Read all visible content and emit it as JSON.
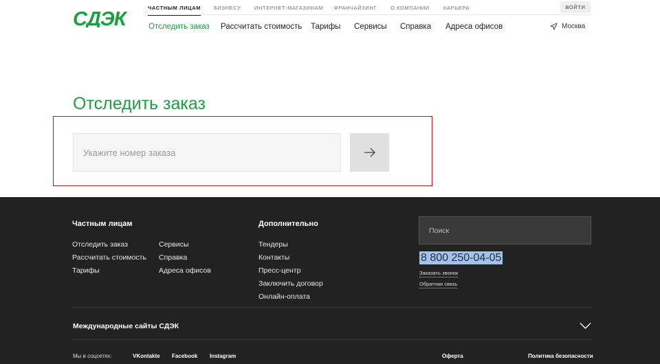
{
  "header": {
    "logo_text": "СДЭК",
    "top_nav": [
      "ЧАСТНЫМ ЛИЦАМ",
      "БИЗНЕСУ",
      "ИНТЕРНЕТ-МАГАЗИНАМ",
      "ФРАНЧАЙЗИНГ",
      "О КОМПАНИИ",
      "КАРЬЕРА"
    ],
    "login_label": "ВОЙТИ",
    "main_nav": [
      "Отследить заказ",
      "Рассчитать стоимость",
      "Тарифы",
      "Сервисы",
      "Справка",
      "Адреса офисов"
    ],
    "city": "Москва"
  },
  "tracking": {
    "title": "Отследить заказ",
    "placeholder": "Укажите номер заказа"
  },
  "footer": {
    "col1_title": "Частным лицам",
    "col1_links": [
      "Отследить заказ",
      "Рассчитать стоимость",
      "Тарифы"
    ],
    "col2_links": [
      "Сервисы",
      "Справка",
      "Адреса офисов"
    ],
    "col3_title": "Дополнительно",
    "col3_links": [
      "Тендеры",
      "Контакты",
      "Пресс-центр",
      "Заключить договор",
      "Онлайн-оплата"
    ],
    "search_placeholder": "Поиск",
    "phone": "8 800 250-04-05",
    "callback_label": "Заказать звонок",
    "feedback_label": "Обратная связь",
    "intl_sites": "Международные сайты СДЭК",
    "social_label": "Мы в соцсетях:",
    "social_links": [
      "VKontakte",
      "Facebook",
      "Instagram"
    ],
    "offer_label": "Оферта",
    "privacy_label": "Политика безопасности"
  },
  "colors": {
    "brand_green": "#1aa03f",
    "footer_bg": "#222222",
    "highlight_box": "#b01a1a"
  }
}
